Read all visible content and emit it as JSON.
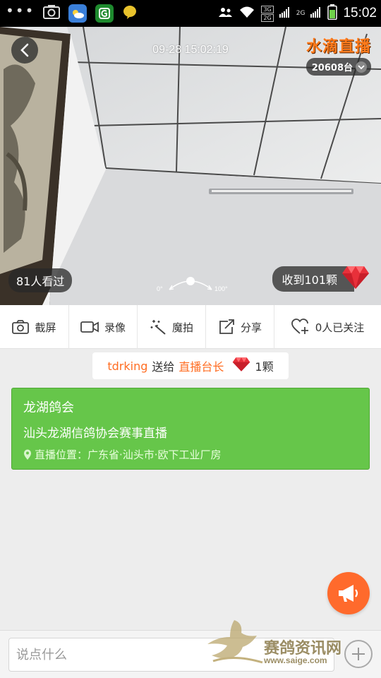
{
  "status_bar": {
    "time": "15:02",
    "signal_label_1": "3G",
    "signal_label_2": "2G",
    "signal_label_3": "2G"
  },
  "video": {
    "timestamp": "09-28 15:02:19",
    "brand_title": "水滴直播",
    "device_count": "20608台",
    "viewed_count": "81人看过",
    "received_gems": "收到101颗",
    "angle_min": "0°",
    "angle_max": "100°",
    "colors": {
      "overlay": "#282828",
      "brand": "#ff7a1a"
    }
  },
  "toolbar": {
    "screenshot_label": "截屏",
    "record_label": "录像",
    "magic_label": "魔拍",
    "share_label": "分享",
    "follow_label": "0人已关注"
  },
  "gift": {
    "user": "tdrking",
    "verb": "送给",
    "target": "直播台长",
    "amount": "1颗",
    "accent_color": "#ff6d22"
  },
  "info_card": {
    "title": "龙湖鸽会",
    "description": "汕头龙湖信鸽协会赛事直播",
    "location": "直播位置：广东省·汕头市·欧下工业厂房",
    "background_color": "#66c64a"
  },
  "comment_input": {
    "placeholder": "说点什么"
  },
  "watermark": {
    "site_name": "赛鸽资讯网",
    "url": "www.saige.com"
  },
  "icons": {
    "back": "chevron-left-icon",
    "camera": "camera-icon",
    "video": "video-camera-icon",
    "magic": "magic-wand-icon",
    "share": "share-icon",
    "follow": "heart-plus-icon",
    "gem": "diamond-icon",
    "broadcast": "megaphone-icon",
    "add": "plus-icon"
  }
}
